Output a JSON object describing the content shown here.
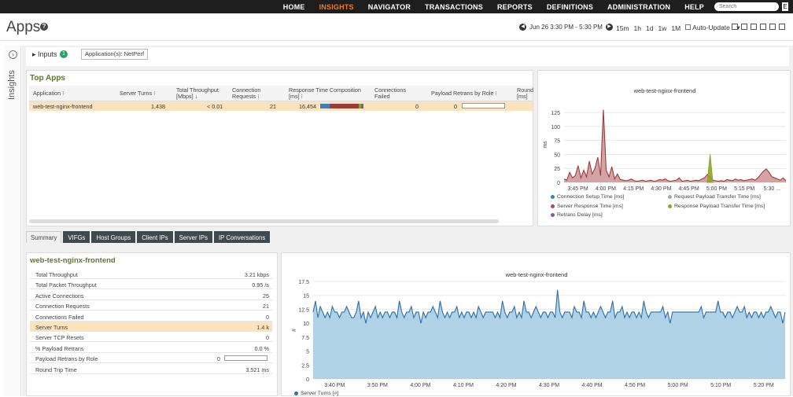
{
  "nav": {
    "items": [
      "HOME",
      "INSIGHTS",
      "NAVIGATOR",
      "TRANSACTIONS",
      "REPORTS",
      "DEFINITIONS",
      "ADMINISTRATION",
      "HELP"
    ],
    "active": "INSIGHTS",
    "search_placeholder": "Search"
  },
  "header": {
    "title": "Apps",
    "time_range": "Jun 26 3:30 PM - 5:30 PM",
    "ranges": [
      "15m",
      "1h",
      "1d",
      "1w",
      "1M"
    ],
    "auto_update": "Auto-Update"
  },
  "sidebar": {
    "label": "Insights"
  },
  "inputs": {
    "label": "Inputs",
    "count": "1",
    "filter": "Application(s): NetPerf"
  },
  "top_apps": {
    "title": "Top Apps",
    "columns": [
      "Application",
      "Server Turns",
      "Total Throughput [Mbps]",
      "Connection Requests",
      "Response Time Composition [ms]",
      "Connections Failed",
      "Payload Retrans by Role",
      "Round [ms]"
    ],
    "row": {
      "application": "web-test-nginx-frontend",
      "server_turns": "1,438",
      "throughput": "< 0.01",
      "conn_requests": "21",
      "response_time": "16,454",
      "conn_failed": "0",
      "payload_retrans": "0"
    }
  },
  "tabs": [
    "Summary",
    "VIFGs",
    "Host Groups",
    "Client IPs",
    "Server IPs",
    "IP Conversations"
  ],
  "summary": {
    "title": "web-test-nginx-frontend",
    "rows": [
      {
        "k": "Total Throughput",
        "v": "3.21 kbps"
      },
      {
        "k": "Total Packet Throughput",
        "v": "0.95 /s"
      },
      {
        "k": "Active Connections",
        "v": "25"
      },
      {
        "k": "Connection Requests",
        "v": "21"
      },
      {
        "k": "Connections Failed",
        "v": "0"
      },
      {
        "k": "Server Turns",
        "v": "1.4 k"
      },
      {
        "k": "Server TCP Resets",
        "v": "0"
      },
      {
        "k": "% Payload Retrans",
        "v": "0.0 %"
      },
      {
        "k": "Payload Retrans by Role",
        "v": "0"
      },
      {
        "k": "Round Trip Time",
        "v": "3.521 ms"
      }
    ]
  },
  "chart_data": [
    {
      "type": "area",
      "title": "web-test-nginx-frontend",
      "ylabel": "ms",
      "ylim": [
        0,
        135
      ],
      "yticks": [
        0,
        25,
        50,
        75,
        100,
        125
      ],
      "x_ticks": [
        "3:45 PM",
        "4:00 PM",
        "4:15 PM",
        "4:30 PM",
        "4:45 PM",
        "5:00 PM",
        "5:15 PM",
        "5:30 ..."
      ],
      "legend": [
        "Connection Setup Time [ms]",
        "Request Payload Transfer Time [ms]",
        "Server Response Time [ms]",
        "Response Payload Transfer Time [ms]",
        "Retrans Delay [ms]"
      ],
      "colors": [
        "#3a7fc1",
        "#8ab8a4",
        "#b24a4a",
        "#8da42a",
        "#7b5ea7"
      ],
      "series": [
        {
          "name": "Server Response Time [ms]",
          "values": [
            6,
            4,
            18,
            8,
            12,
            30,
            8,
            22,
            10,
            38,
            15,
            25,
            45,
            12,
            130,
            22,
            10,
            28,
            6,
            15,
            5,
            4,
            3,
            4,
            6,
            3,
            2,
            3,
            4,
            2,
            3,
            4,
            2,
            3,
            5,
            4,
            6,
            3,
            2,
            3,
            4,
            8,
            2,
            3,
            4,
            2,
            3,
            4,
            3,
            6,
            8,
            14,
            10,
            4,
            3,
            2,
            3,
            2,
            5,
            4,
            3,
            6,
            4,
            5,
            3,
            4,
            5,
            6,
            4,
            8,
            14,
            20,
            24,
            18,
            10,
            8,
            6,
            4,
            8,
            3
          ]
        },
        {
          "name": "Response Payload Transfer Time [ms]",
          "values": [
            0,
            0,
            0,
            0,
            0,
            0,
            0,
            0,
            0,
            0,
            0,
            0,
            0,
            0,
            0,
            0,
            0,
            0,
            0,
            0,
            0,
            0,
            0,
            0,
            0,
            0,
            0,
            0,
            0,
            0,
            0,
            0,
            0,
            0,
            0,
            0,
            0,
            0,
            0,
            0,
            0,
            0,
            0,
            0,
            0,
            0,
            0,
            0,
            0,
            0,
            0,
            0,
            0,
            0,
            0,
            0,
            0,
            0,
            0,
            0,
            0,
            0,
            0,
            0,
            0,
            0,
            0,
            0,
            0,
            0,
            0,
            0,
            0,
            0,
            0,
            0,
            0,
            0,
            0,
            0
          ]
        },
        {
          "name": "Request Payload Transfer Time [ms]",
          "values": [
            0,
            0,
            0,
            0,
            0,
            0,
            0,
            0,
            0,
            0,
            0,
            0,
            0,
            0,
            0,
            0,
            0,
            0,
            0,
            0,
            0,
            0,
            0,
            0,
            0,
            0,
            0,
            0,
            0,
            0,
            0,
            0,
            0,
            0,
            0,
            0,
            0,
            0,
            0,
            0,
            0,
            0,
            0,
            0,
            0,
            0,
            0,
            0,
            0,
            0,
            0,
            0,
            0,
            0,
            0,
            0,
            0,
            0,
            0,
            0,
            0,
            0,
            0,
            0,
            0,
            0,
            0,
            0,
            0,
            0,
            0,
            0,
            0,
            0,
            0,
            0,
            0,
            0,
            0,
            0
          ]
        }
      ],
      "spike_secondary": {
        "series": "Response Payload Transfer Time [ms]",
        "at_index": 52,
        "value": 50
      }
    },
    {
      "type": "area",
      "title": "web-test-nginx-frontend",
      "ylabel": "#",
      "ylim": [
        0,
        17.5
      ],
      "yticks": [
        0,
        2.5,
        5,
        7.5,
        10,
        12.5,
        15,
        17.5
      ],
      "x_ticks": [
        "3:40 PM",
        "3:50 PM",
        "4:00 PM",
        "4:10 PM",
        "4:20 PM",
        "4:30 PM",
        "4:40 PM",
        "4:50 PM",
        "5:00 PM",
        "5:10 PM",
        "5:20 PM"
      ],
      "legend": [
        "Server Turns [#]"
      ],
      "colors": [
        "#a7cde3",
        "#2f6fa3"
      ],
      "series": [
        {
          "name": "Server Turns [#]",
          "values": [
            12,
            14,
            11,
            13,
            12,
            11,
            12,
            11,
            13,
            12,
            12,
            11,
            12,
            12,
            13,
            12,
            11,
            11,
            12,
            14,
            11,
            12,
            10,
            12,
            11,
            12,
            13,
            11,
            12,
            11,
            12,
            12,
            11,
            12,
            12,
            11,
            14,
            12,
            11,
            12,
            12,
            13,
            11,
            12,
            12,
            10,
            12,
            11,
            12,
            12,
            13,
            12,
            11,
            14,
            12,
            11,
            12,
            11,
            12,
            12,
            13,
            11,
            12,
            11,
            12,
            12,
            11,
            12,
            11,
            13,
            12,
            11,
            12,
            12,
            12,
            12,
            11,
            12,
            11,
            14,
            12,
            11,
            12,
            12,
            13,
            11,
            12,
            11,
            14,
            12,
            12,
            11,
            12,
            13,
            12,
            11,
            12,
            12,
            11,
            12,
            12,
            11,
            16,
            12,
            11,
            12,
            12,
            12,
            11,
            13,
            12,
            12,
            11,
            14,
            12,
            12,
            11,
            12,
            11,
            12,
            13,
            12,
            11,
            12,
            12,
            14,
            11,
            12,
            12,
            13,
            11,
            12,
            11,
            12,
            12,
            11,
            12,
            11,
            14,
            12,
            11,
            12,
            12,
            12,
            12,
            12,
            13,
            11,
            12,
            10,
            12,
            12,
            12,
            12,
            12,
            12,
            12,
            12,
            12,
            12,
            12,
            12,
            13,
            11,
            12,
            12,
            12,
            12,
            12,
            14,
            12,
            12,
            11,
            12,
            12,
            11,
            12,
            13,
            12,
            12,
            13,
            11,
            12,
            11,
            12,
            12,
            11,
            12,
            11,
            12,
            12,
            13,
            12,
            11,
            12,
            12,
            10,
            12
          ]
        }
      ]
    }
  ]
}
